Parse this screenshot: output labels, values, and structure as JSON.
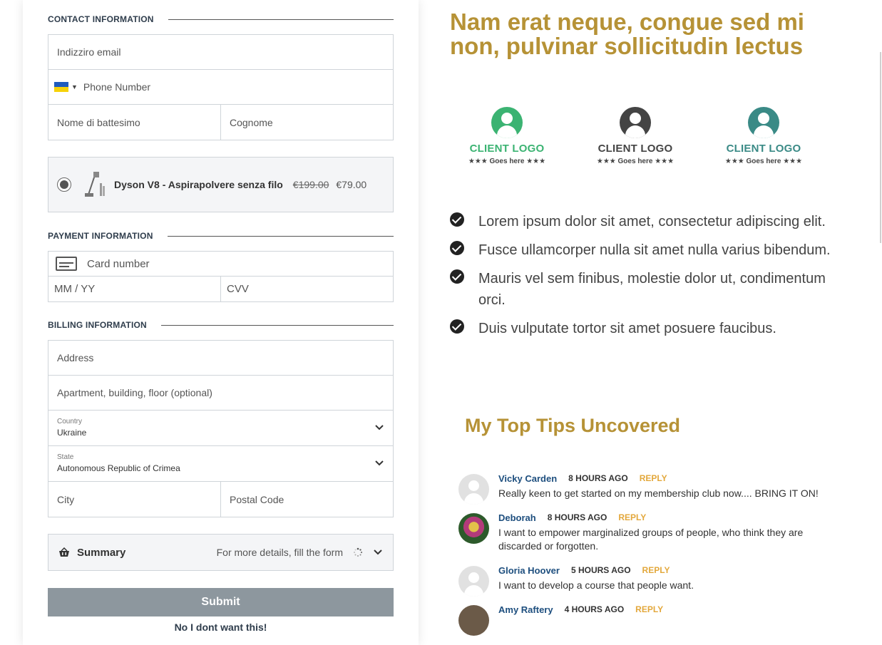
{
  "contact": {
    "section_title": "CONTACT INFORMATION",
    "email_placeholder": "Indizziro email",
    "phone_placeholder": "Phone Number",
    "first_name_placeholder": "Nome di battesimo",
    "last_name_placeholder": "Cognome"
  },
  "product": {
    "name": "Dyson V8 - Aspirapolvere senza filo",
    "old_price": "€199.00",
    "new_price": "€79.00"
  },
  "payment": {
    "section_title": "PAYMENT INFORMATION",
    "card_number_placeholder": "Card number",
    "expiry_placeholder": "MM / YY",
    "cvv_placeholder": "CVV"
  },
  "billing": {
    "section_title": "BILLING INFORMATION",
    "address_placeholder": "Address",
    "apartment_placeholder": "Apartment, building, floor (optional)",
    "country_label": "Country",
    "country_value": "Ukraine",
    "state_label": "State",
    "state_value": "Autonomous Republic of Crimea",
    "city_placeholder": "City",
    "postal_placeholder": "Postal Code"
  },
  "summary": {
    "title": "Summary",
    "hint": "For more details, fill the form"
  },
  "actions": {
    "submit_label": "Submit",
    "decline_label": "No I dont want this!"
  },
  "content": {
    "headline": "Nam erat neque, congue sed mi non, pulvinar sollicitudin lectus",
    "logos": [
      {
        "name": "CLIENT LOGO",
        "tagline": "★★★  Goes here  ★★★",
        "color": "#3bb372"
      },
      {
        "name": "CLIENT LOGO",
        "tagline": "★★★  Goes here  ★★★",
        "color": "#444444"
      },
      {
        "name": "CLIENT LOGO",
        "tagline": "★★★  Goes here  ★★★",
        "color": "#3a8a86"
      }
    ],
    "bullets": [
      "Lorem ipsum dolor sit amet, consectetur adipiscing elit.",
      "Fusce ullamcorper nulla sit amet nulla varius bibendum.",
      "Mauris vel sem finibus, molestie dolor ut, condimentum orci.",
      "Duis vulputate tortor sit amet posuere faucibus."
    ],
    "tips_title": "My Top Tips Uncovered"
  },
  "comments": [
    {
      "author": "Vicky Carden",
      "time": "8 HOURS AGO",
      "reply": "REPLY",
      "text": "Really keen to get started on my membership club now.... BRING IT ON!"
    },
    {
      "author": "Deborah",
      "time": "8 HOURS AGO",
      "reply": "REPLY",
      "text": "I want to empower marginalized groups of people, who think they are discarded or forgotten."
    },
    {
      "author": "Gloria Hoover",
      "time": "5 HOURS AGO",
      "reply": "REPLY",
      "text": "I want to develop a course that people want."
    },
    {
      "author": "Amy Raftery",
      "time": "4 HOURS AGO",
      "reply": "REPLY",
      "text": ""
    }
  ],
  "colors": {
    "accent_gold": "#b69236",
    "author_blue": "#1d4e7e",
    "reply_orange": "#e3a83c",
    "submit_gray": "#8d979e"
  }
}
